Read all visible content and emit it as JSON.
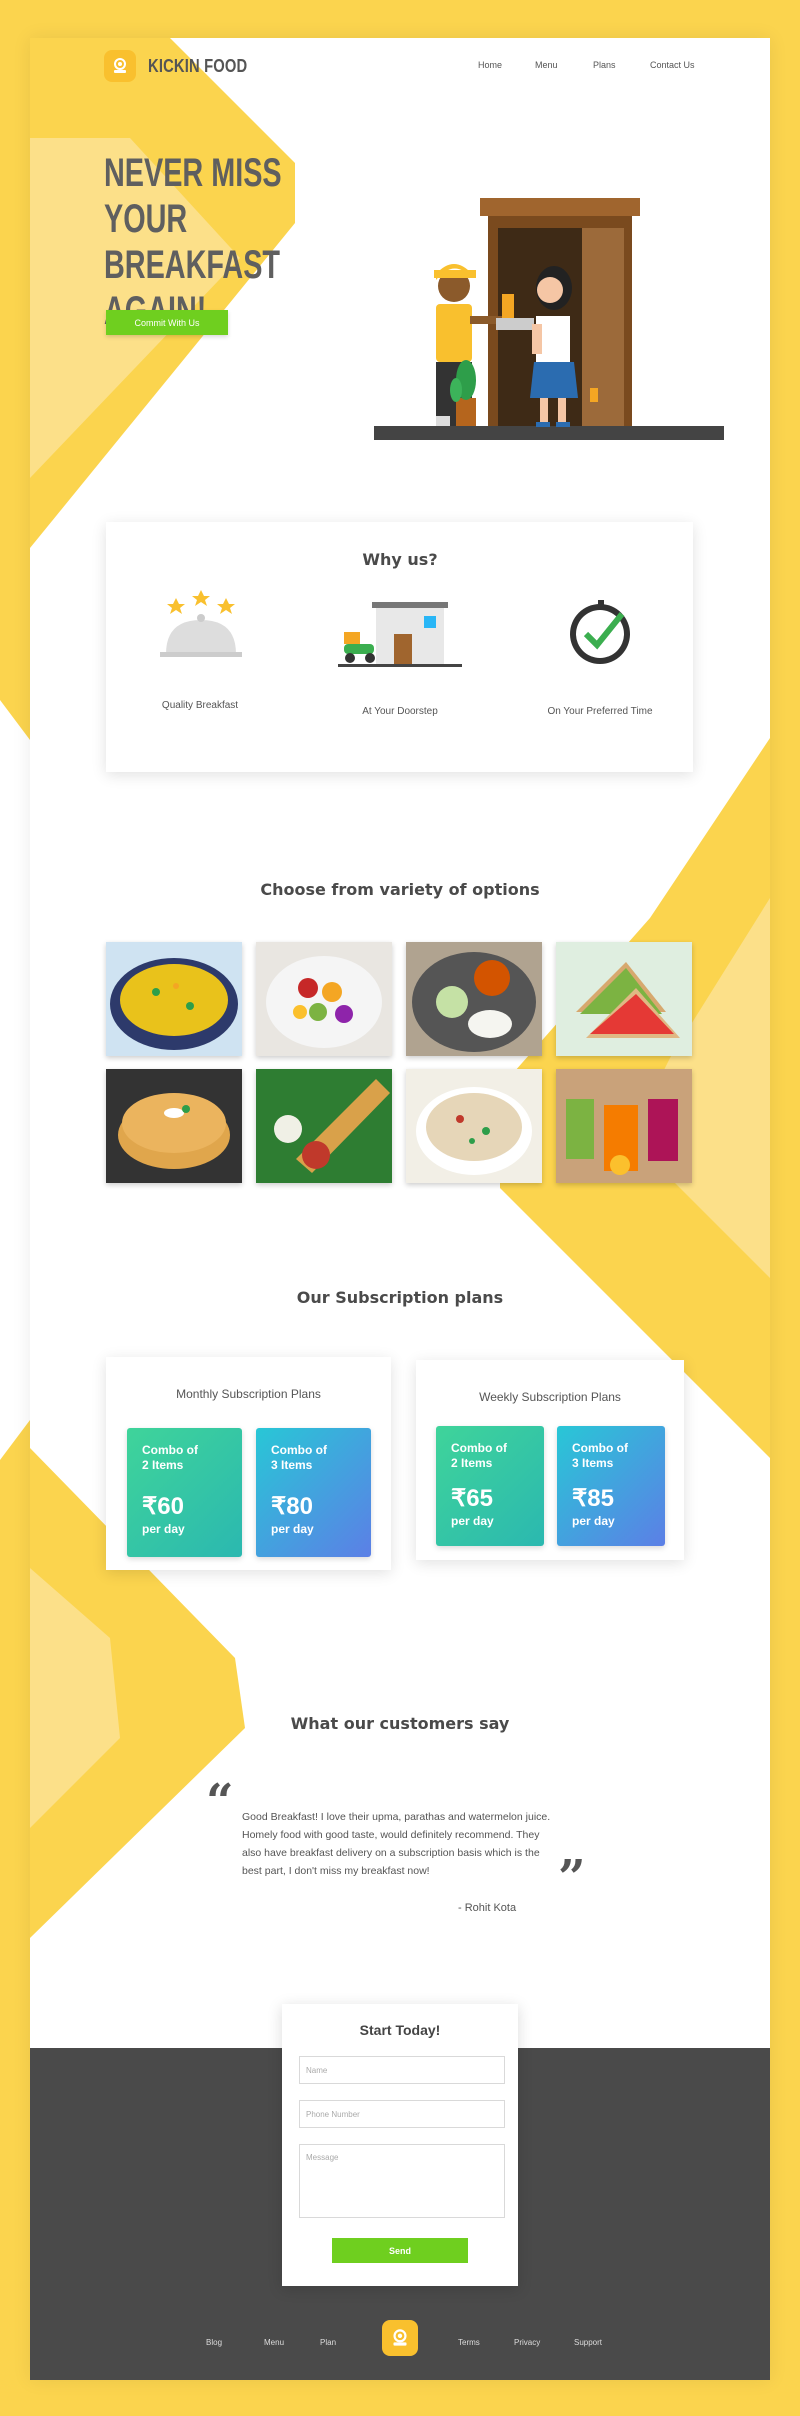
{
  "brand": {
    "name": "KICKIN FOOD"
  },
  "nav": {
    "home": "Home",
    "menu": "Menu",
    "plans": "Plans",
    "contact": "Contact Us"
  },
  "hero": {
    "line1": "NEVER MISS YOUR",
    "line2": "BREAKFAST",
    "line3": "AGAIN!",
    "cta": "Commit With Us"
  },
  "why": {
    "title": "Why us?",
    "items": [
      {
        "label": "Quality Breakfast",
        "icon": "cloche-icon"
      },
      {
        "label": "At Your Doorstep",
        "icon": "delivery-shop-icon"
      },
      {
        "label": "On Your Preferred Time",
        "icon": "clock-check-icon"
      }
    ]
  },
  "options": {
    "title": "Choose from variety of options",
    "items": [
      "poha",
      "fruit-salad",
      "idli-sambar",
      "sandwich",
      "paratha",
      "dosa",
      "upma",
      "juices"
    ]
  },
  "plans": {
    "title": "Our Subscription plans",
    "monthly": {
      "title": "Monthly Subscription Plans",
      "tiles": [
        {
          "combo1": "Combo of",
          "combo2": "2 Items",
          "price": "₹60",
          "per": "per day"
        },
        {
          "combo1": "Combo of",
          "combo2": "3 Items",
          "price": "₹80",
          "per": "per day"
        }
      ]
    },
    "weekly": {
      "title": "Weekly Subscription Plans",
      "tiles": [
        {
          "combo1": "Combo of",
          "combo2": "2 Items",
          "price": "₹65",
          "per": "per day"
        },
        {
          "combo1": "Combo of",
          "combo2": "3 Items",
          "price": "₹85",
          "per": "per day"
        }
      ]
    }
  },
  "testimonials": {
    "title": "What our customers say",
    "open_quote": "“",
    "close_quote": "”",
    "line1": "Good Breakfast! I love their upma, parathas and watermelon juice.",
    "line2": "Homely food with good taste, would definitely recommend. They",
    "line3": "also have breakfast delivery on a subscription basis which is the",
    "line4": "best part, I don't miss my breakfast now!",
    "author": "- Rohit Kota"
  },
  "form": {
    "title": "Start Today!",
    "name_placeholder": "Name",
    "phone_placeholder": "Phone Number",
    "message_placeholder": "Message",
    "send": "Send"
  },
  "footer": {
    "blog": "Blog",
    "menu": "Menu",
    "plan": "Plan",
    "terms": "Terms",
    "privacy": "Privacy",
    "support": "Support"
  },
  "colors": {
    "yellow": "#FBD44E",
    "green": "#6FCF1F",
    "dark": "#4a4a4a",
    "text": "#555555"
  }
}
